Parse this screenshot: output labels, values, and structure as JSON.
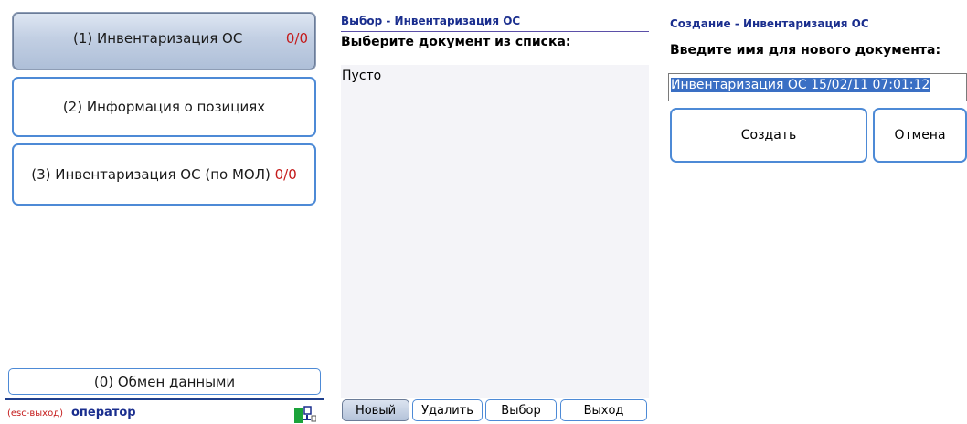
{
  "menu": {
    "items": [
      {
        "label": "(1) Инвентаризация ОС",
        "counter": "0/0"
      },
      {
        "label": "(2) Информация о позициях"
      },
      {
        "label": "(3) Инвентаризация ОС (по МОЛ)",
        "counter": "0/0"
      }
    ],
    "exchange_label": "(0) Обмен данными",
    "status": {
      "esc_hint": "(esc-выход)",
      "operator": "оператор"
    }
  },
  "select_panel": {
    "title": "Выбор - Инвентаризация ОС",
    "prompt": "Выберите документ из списка:",
    "empty_text": "Пусто",
    "buttons": {
      "new": "Новый",
      "delete": "Удалить",
      "select": "Выбор",
      "exit": "Выход"
    }
  },
  "create_panel": {
    "title": "Создание - Инвентаризация ОС",
    "prompt": "Введите имя для нового документа:",
    "input_value": "Инвентаризация ОС 15/02/11 07:01:12",
    "buttons": {
      "create": "Создать",
      "cancel": "Отмена"
    }
  },
  "colors": {
    "accent": "#4d8ad6",
    "counter": "#c41a1a",
    "title": "#1a2e8e"
  }
}
